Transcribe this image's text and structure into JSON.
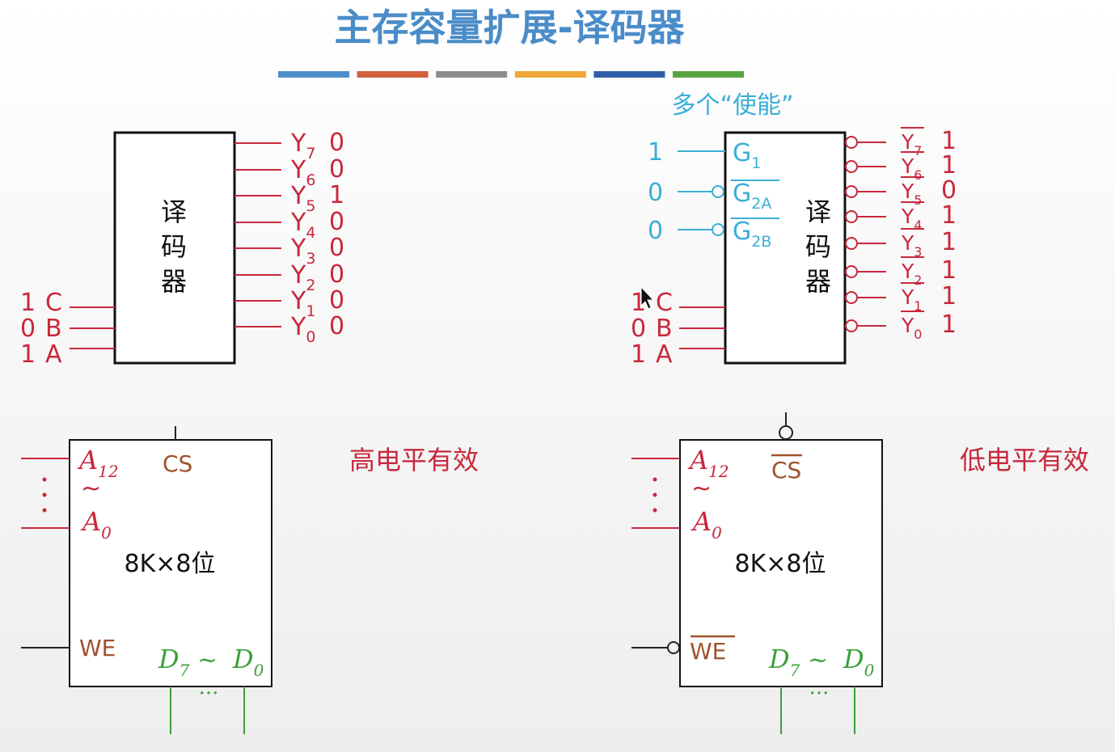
{
  "slide_title": "主存容量扩展-译码器",
  "color_bar": [
    "#4f8fc9",
    "#d26040",
    "#8c8c8c",
    "#f0a83a",
    "#2f5fa8",
    "#58a540"
  ],
  "enable_caption": "多个“使能”",
  "decoder1": {
    "label_chars": [
      "译",
      "码",
      "器"
    ],
    "inputs": [
      {
        "value": "1",
        "name": "C"
      },
      {
        "value": "0",
        "name": "B"
      },
      {
        "value": "1",
        "name": "A"
      }
    ],
    "outputs": [
      {
        "name": "Y",
        "sub": "7",
        "value": "0"
      },
      {
        "name": "Y",
        "sub": "6",
        "value": "0"
      },
      {
        "name": "Y",
        "sub": "5",
        "value": "1"
      },
      {
        "name": "Y",
        "sub": "4",
        "value": "0"
      },
      {
        "name": "Y",
        "sub": "3",
        "value": "0"
      },
      {
        "name": "Y",
        "sub": "2",
        "value": "0"
      },
      {
        "name": "Y",
        "sub": "1",
        "value": "0"
      },
      {
        "name": "Y",
        "sub": "0",
        "value": "0"
      }
    ]
  },
  "decoder2": {
    "label_chars": [
      "译",
      "码",
      "器"
    ],
    "enables": [
      {
        "value": "1",
        "name": "G",
        "sub": "1",
        "inverted": false
      },
      {
        "value": "0",
        "name": "G",
        "sub": "2A",
        "inverted": true
      },
      {
        "value": "0",
        "name": "G",
        "sub": "2B",
        "inverted": true
      }
    ],
    "inputs": [
      {
        "value": "1",
        "name": "C"
      },
      {
        "value": "0",
        "name": "B"
      },
      {
        "value": "1",
        "name": "A"
      }
    ],
    "outputs": [
      {
        "name": "Y",
        "sub": "7",
        "value": "1"
      },
      {
        "name": "Y",
        "sub": "6",
        "value": "1"
      },
      {
        "name": "Y",
        "sub": "5",
        "value": "0"
      },
      {
        "name": "Y",
        "sub": "4",
        "value": "1"
      },
      {
        "name": "Y",
        "sub": "3",
        "value": "1"
      },
      {
        "name": "Y",
        "sub": "2",
        "value": "1"
      },
      {
        "name": "Y",
        "sub": "1",
        "value": "1"
      },
      {
        "name": "Y",
        "sub": "0",
        "value": "1"
      }
    ]
  },
  "chip1": {
    "addr_hi": {
      "name": "A",
      "sub": "12"
    },
    "tilde": "~",
    "addr_lo": {
      "name": "A",
      "sub": "0"
    },
    "cs": "CS",
    "size": "8K×8位",
    "we": "WE",
    "data_hi": {
      "name": "D",
      "sub": "7"
    },
    "data_lo": {
      "name": "D",
      "sub": "0"
    },
    "ellipsis": "···",
    "caption": "高电平有效"
  },
  "chip2": {
    "addr_hi": {
      "name": "A",
      "sub": "12"
    },
    "tilde": "~",
    "addr_lo": {
      "name": "A",
      "sub": "0"
    },
    "cs": "CS",
    "size": "8K×8位",
    "we": "WE",
    "data_hi": {
      "name": "D",
      "sub": "7"
    },
    "data_lo": {
      "name": "D",
      "sub": "0"
    },
    "ellipsis": "···",
    "caption": "低电平有效"
  }
}
